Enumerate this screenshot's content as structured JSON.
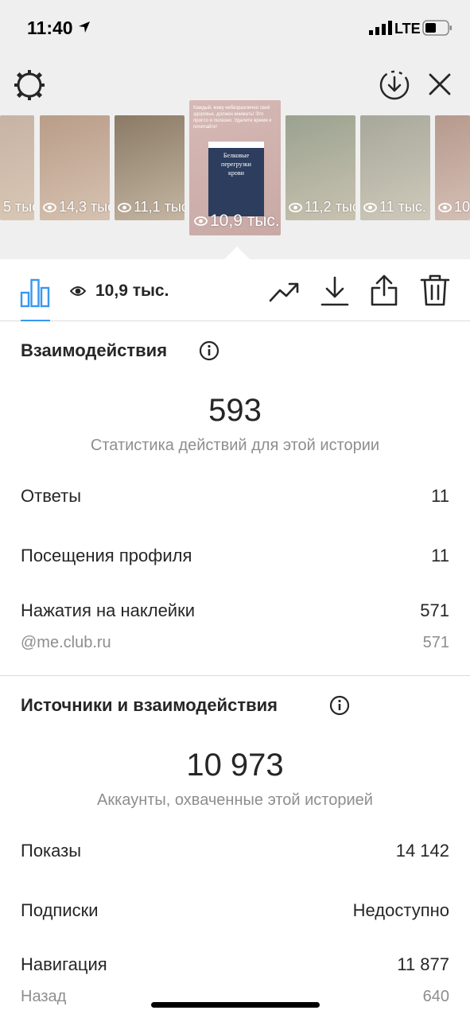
{
  "status_bar": {
    "time": "11:40",
    "network": "LTE"
  },
  "thumbnails": [
    {
      "views": "5 тыс.",
      "palette": [
        "#c7b3a4",
        "#d9c7b5"
      ]
    },
    {
      "views": "14,3 тыс.",
      "palette": [
        "#b99d88",
        "#d6c2b1"
      ]
    },
    {
      "views": "11,1 тыс.",
      "palette": [
        "#8a7a66",
        "#c4b6a2"
      ]
    },
    {
      "views": "10,9 тыс.",
      "palette": [
        "#d6b8b4",
        "#c8a9a5"
      ]
    },
    {
      "views": "11,2 тыс.",
      "palette": [
        "#9aa28f",
        "#c9c2b1"
      ]
    },
    {
      "views": "11 тыс.",
      "palette": [
        "#a7a89a",
        "#cfc9bb"
      ]
    },
    {
      "views": "10",
      "palette": [
        "#b6998d",
        "#d4bfb4"
      ]
    }
  ],
  "selected_story": {
    "caption": "Каждый, кому небезразлично своё здоровье, должен внимать! Это просто и полезно. Удалите время и почитайте!",
    "card_color": "#2c3d5e",
    "card_title": "Белковые перегрузки крови"
  },
  "toolbar": {
    "views": "10,9 тыс."
  },
  "interactions": {
    "title": "Взаимодействия",
    "total": "593",
    "subtitle": "Статистика действий для этой истории",
    "rows": [
      {
        "label": "Ответы",
        "value": "11"
      },
      {
        "label": "Посещения профиля",
        "value": "11"
      },
      {
        "label": "Нажатия на наклейки",
        "value": "571"
      }
    ],
    "sticker": {
      "label": "@me.club.ru",
      "value": "571"
    }
  },
  "discovery": {
    "title": "Источники и взаимодействия",
    "total": "10 973",
    "subtitle": "Аккаунты, охваченные этой историей",
    "rows": [
      {
        "label": "Показы",
        "value": "14 142"
      },
      {
        "label": "Подписки",
        "value": "Недоступно"
      },
      {
        "label": "Навигация",
        "value": "11 877"
      }
    ],
    "back": {
      "label": "Назад",
      "value": "640"
    }
  },
  "colors": {
    "accent": "#3897f0",
    "text": "#262626",
    "muted": "#8e8e8e",
    "background_top": "#efefef"
  }
}
